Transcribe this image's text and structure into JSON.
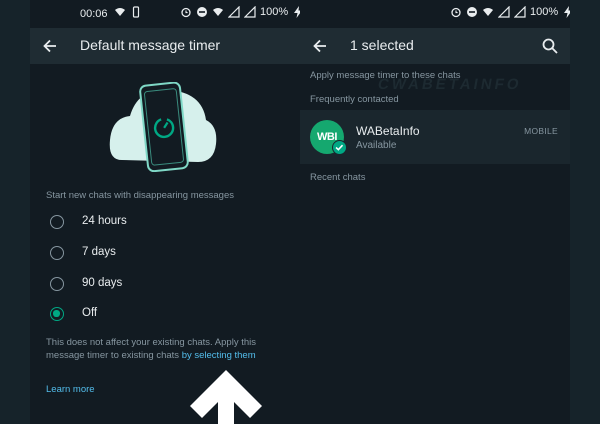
{
  "status_bar": {
    "time": "00:06",
    "battery": "100%"
  },
  "timer_screen": {
    "title": "Default message timer",
    "section_label": "Start new chats with disappearing messages",
    "options": [
      {
        "label": "24 hours",
        "selected": false
      },
      {
        "label": "7 days",
        "selected": false
      },
      {
        "label": "90 days",
        "selected": false
      },
      {
        "label": "Off",
        "selected": true
      }
    ],
    "note": "This does not affect your existing chats. Apply this message timer to existing chats ",
    "note_link": "by selecting them",
    "learn_more": "Learn more",
    "icons": {
      "back": "arrow-left-icon",
      "illustration": "phone-timer-icon",
      "pointer": "arrow-up-icon"
    }
  },
  "select_screen": {
    "title": "1 selected",
    "header": "Apply  message timer to these chats",
    "frequent_label": "Frequently contacted",
    "watermark": "CWABETAINFO",
    "contact": {
      "avatar_text": "WBI",
      "name": "WABetaInfo",
      "status": "Available",
      "meta": "MOBILE"
    },
    "recent_label": "Recent chats",
    "icons": {
      "back": "arrow-left-icon",
      "search": "search-icon",
      "selected": "check-icon"
    }
  },
  "colors": {
    "accent": "#00a884",
    "link": "#53bdeb",
    "background": "#121b22",
    "appbar": "#1f2c33"
  }
}
